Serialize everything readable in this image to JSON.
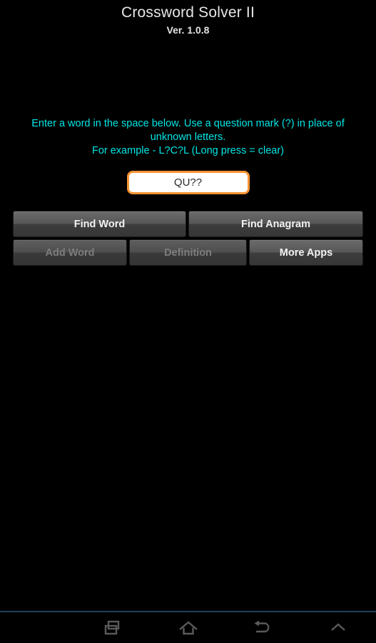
{
  "app": {
    "title": "Crossword Solver II",
    "version": "Ver. 1.0.8"
  },
  "instructions": {
    "line1": "Enter a word in the space below. Use a question mark (?) in place of unknown letters.",
    "line2": "For example - L?C?L (Long press = clear)"
  },
  "input": {
    "value": "QU??",
    "placeholder": ""
  },
  "buttons": {
    "find_word": "Find Word",
    "find_anagram": "Find Anagram",
    "add_word": "Add Word",
    "definition": "Definition",
    "more_apps": "More Apps"
  },
  "navbar": {
    "recents": "recents-icon",
    "home": "home-icon",
    "back": "back-icon",
    "expand": "chevron-up-icon"
  },
  "colors": {
    "background": "#000000",
    "instruction_text": "#00e6e6",
    "input_border": "#f79334",
    "input_background": "#ffffff",
    "title_text": "#e8e8e8",
    "button_text": "#f2f2f2",
    "button_text_disabled": "#7d7d7d",
    "nav_icon": "#5a5a5a",
    "nav_divider": "#1c4256"
  }
}
